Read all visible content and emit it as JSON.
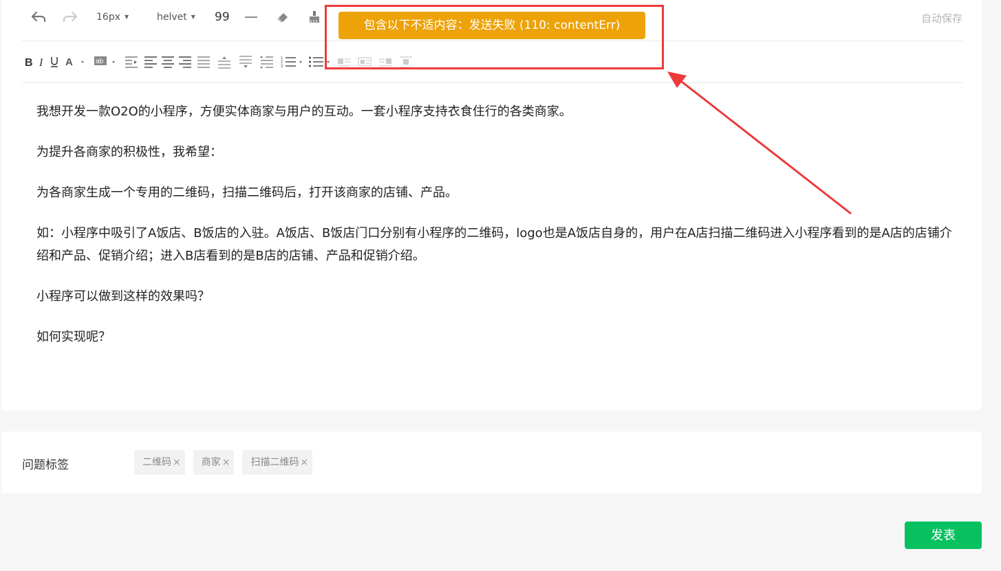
{
  "toolbar": {
    "font_size": "16px",
    "font_family": "helvet",
    "line_height_value": "99",
    "autosave_label": "自动保存",
    "icons_row1": [
      "undo-icon",
      "redo-icon",
      "eraser-icon",
      "format-painter-icon"
    ],
    "icons_row2": [
      "bold-icon",
      "italic-icon",
      "underline-icon",
      "font-color-icon",
      "background-color-icon",
      "indent-icon",
      "align-left-icon",
      "align-center-icon",
      "align-right-icon",
      "align-justify-icon",
      "space-before-icon",
      "space-after-icon",
      "line-spacing-icon",
      "ordered-list-icon",
      "unordered-list-icon",
      "image-left-icon",
      "image-none-icon",
      "image-right-icon",
      "image-center-icon"
    ]
  },
  "toast": {
    "message": "包含以下不适内容：发送失败 (110: contentErr)",
    "color": "#eda208"
  },
  "annotation": {
    "color": "#ee3a3a"
  },
  "editor": {
    "paragraphs": [
      "我想开发一款O2O的小程序，方便实体商家与用户的互动。一套小程序支持衣食住行的各类商家。",
      "为提升各商家的积极性，我希望：",
      "为各商家生成一个专用的二维码，扫描二维码后，打开该商家的店铺、产品。",
      "如：小程序中吸引了A饭店、B饭店的入驻。A饭店、B饭店门口分别有小程序的二维码，logo也是A饭店自身的，用户在A店扫描二维码进入小程序看到的是A店的店铺介绍和产品、促销介绍；进入B店看到的是B店的店铺、产品和促销介绍。",
      "小程序可以做到这样的效果吗？",
      "如何实现呢？"
    ]
  },
  "tags_section": {
    "label": "问题标签",
    "tags": [
      "二维码",
      "商家",
      "扫描二维码"
    ],
    "remove_symbol": "×"
  },
  "publish_button": {
    "label": "发表",
    "color": "#07c160"
  }
}
